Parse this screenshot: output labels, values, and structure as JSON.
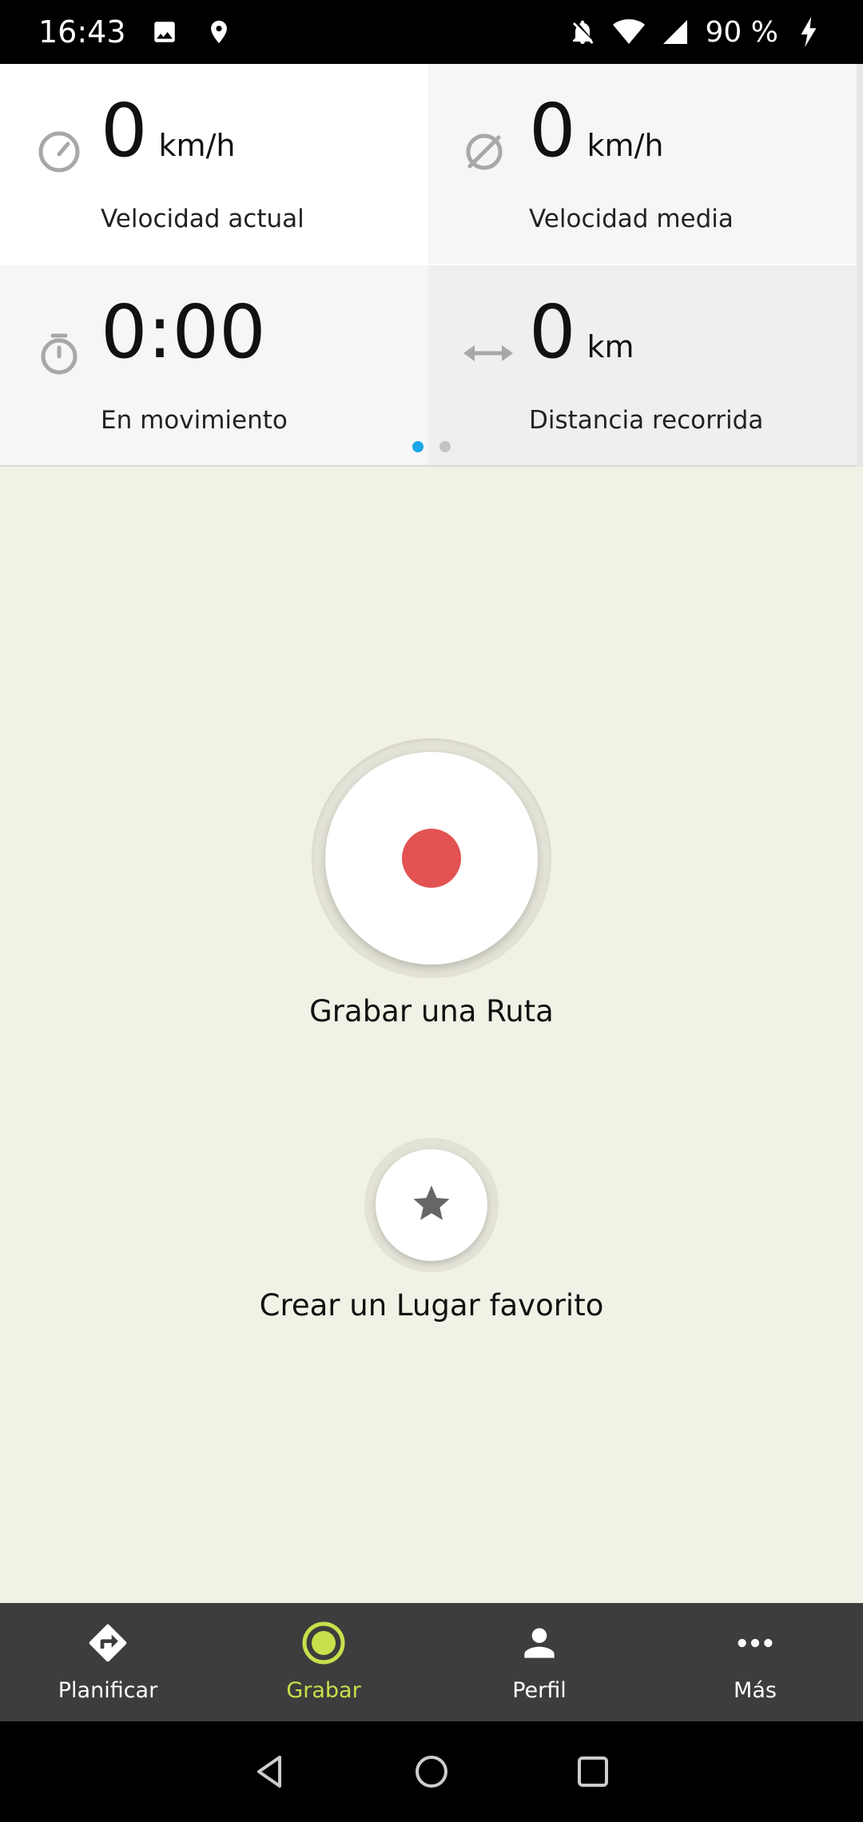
{
  "status_bar": {
    "time": "16:43",
    "battery": "90 %",
    "icons": [
      "image-icon",
      "location-icon",
      "notifications-off-icon",
      "wifi-icon",
      "signal-icon",
      "charging-icon"
    ]
  },
  "stats": {
    "current_speed": {
      "value": "0",
      "unit": "km/h",
      "label": "Velocidad actual",
      "icon": "speedometer-icon"
    },
    "average_speed": {
      "value": "0",
      "unit": "km/h",
      "label": "Velocidad media",
      "icon": "average-icon"
    },
    "moving_time": {
      "value": "0:00",
      "unit": "",
      "label": "En movimiento",
      "icon": "stopwatch-icon"
    },
    "distance": {
      "value": "0",
      "unit": "km",
      "label": "Distancia recorrida",
      "icon": "distance-arrows-icon"
    },
    "pages": 2,
    "active_page": 1
  },
  "actions": {
    "record_label": "Grabar una Ruta",
    "favorite_label": "Crear un Lugar favorito"
  },
  "bottom_nav": {
    "items": [
      {
        "label": "Planificar",
        "icon": "directions-icon"
      },
      {
        "label": "Grabar",
        "icon": "record-icon",
        "active": true
      },
      {
        "label": "Perfil",
        "icon": "person-icon"
      },
      {
        "label": "Más",
        "icon": "more-icon"
      }
    ]
  },
  "colors": {
    "accent_active": "#c6e14b",
    "record_red": "#e25252",
    "page_dot_active": "#1aa6e8",
    "background": "#f2f1e6",
    "nav_background": "#3d3d3d"
  }
}
